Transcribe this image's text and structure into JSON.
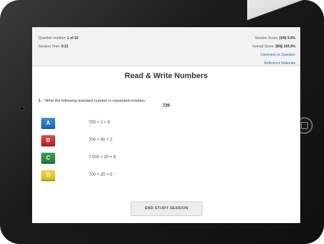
{
  "session": {
    "question_label": "Question number:",
    "question_number": "1 of 10",
    "time_label": "Session Time:",
    "time_value": "0:21",
    "score_label": "Session Score:",
    "score_value": "(0/0) 0.0%",
    "overall_label": "Overall Score:",
    "overall_value": "(8/8) 100.0%",
    "comment_link": "Comment on Question",
    "reference_link": "Reference Materials"
  },
  "lesson": {
    "title": "Read & Write Numbers",
    "question_number": "1.",
    "question_text": "Write the following standard number in expanded notation.",
    "given_number": "729"
  },
  "answers": [
    {
      "letter": "A",
      "text": "700 + 2 + 9",
      "color": "#1f66b3"
    },
    {
      "letter": "B",
      "text": "700 + 90 + 2",
      "color": "#b62226"
    },
    {
      "letter": "C",
      "text": "7,000 + 20 + 9",
      "color": "#23783b"
    },
    {
      "letter": "D",
      "text": "700 + 20 + 9",
      "color": "#d4b11f"
    }
  ],
  "actions": {
    "end_session": "END STUDY SESSION"
  }
}
